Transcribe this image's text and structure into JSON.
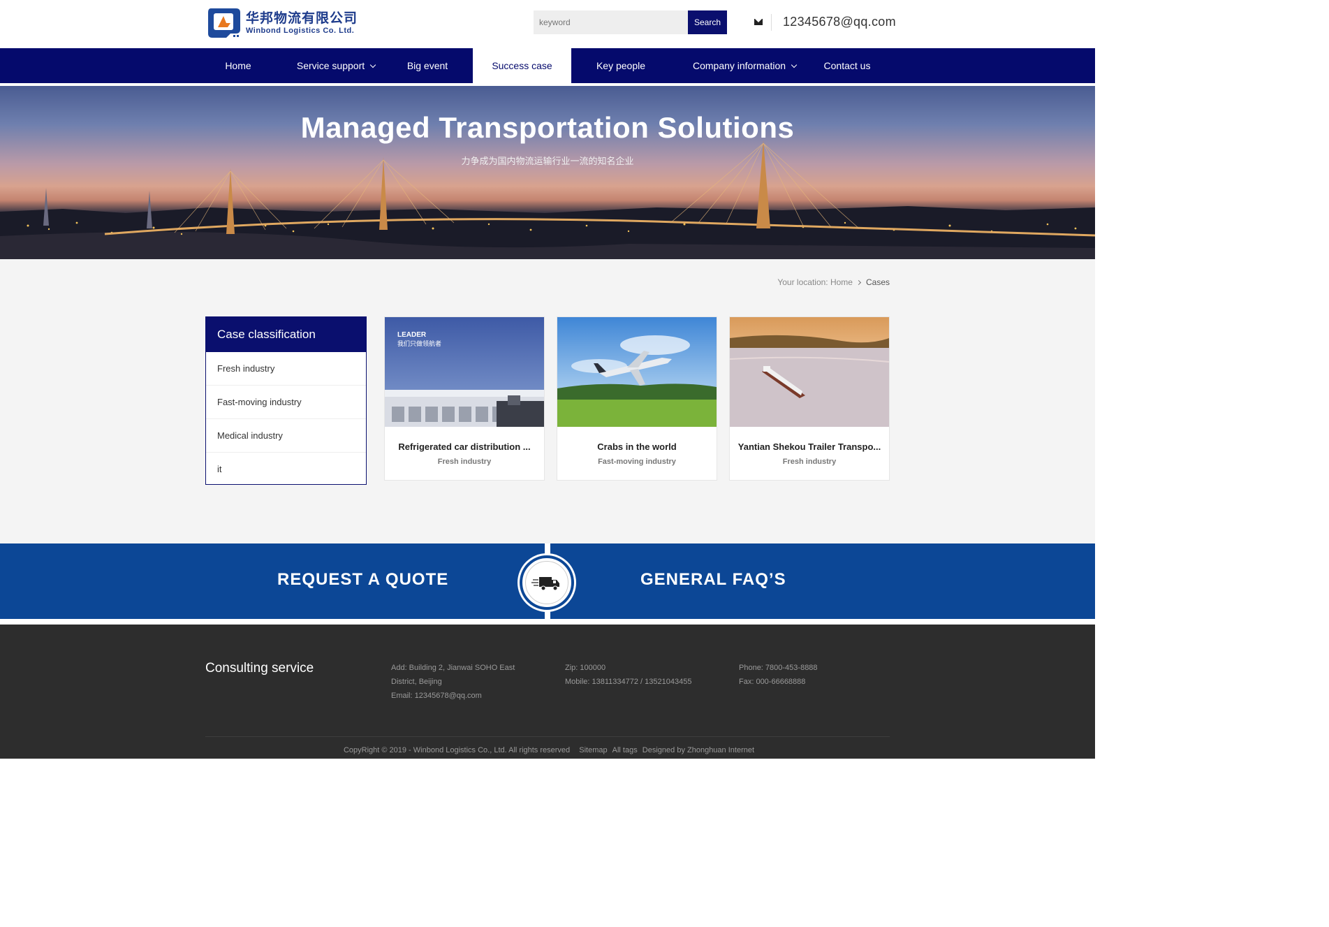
{
  "header": {
    "logo_cn": "华邦物流有限公司",
    "logo_en": "Winbond Logistics Co. Ltd.",
    "search_placeholder": "keyword",
    "search_button": "Search",
    "email": "12345678@qq.com"
  },
  "nav": {
    "items": [
      {
        "label": "Home"
      },
      {
        "label": "Service support"
      },
      {
        "label": "Big event"
      },
      {
        "label": "Success case"
      },
      {
        "label": "Key people"
      },
      {
        "label": "Company information"
      },
      {
        "label": "Contact us"
      }
    ],
    "active": "Success case"
  },
  "banner": {
    "title": "Managed Transportation Solutions",
    "subtitle": "力争成为国内物流运输行业一流的知名企业"
  },
  "breadcrumb": {
    "prefix": "Your location:",
    "home": "Home",
    "current": "Cases"
  },
  "sidebar": {
    "title": "Case classification",
    "items": [
      {
        "label": "Fresh industry"
      },
      {
        "label": "Fast-moving industry"
      },
      {
        "label": "Medical industry"
      },
      {
        "label": "it"
      }
    ]
  },
  "cases": [
    {
      "title": "Refrigerated car distribution ...",
      "category": "Fresh industry",
      "image_text": "LEADER",
      "image_subtext": "我们只做领航者"
    },
    {
      "title": "Crabs in the world",
      "category": "Fast-moving industry"
    },
    {
      "title": "Yantian Shekou Trailer Transpo...",
      "category": "Fresh industry"
    }
  ],
  "quote_bar": {
    "left": "REQUEST A QUOTE",
    "right": "GENERAL FAQ’S",
    "center_icon": "truck-icon"
  },
  "footer": {
    "title": "Consulting service",
    "address_1": "Add: Building 2, Jianwai SOHO East",
    "address_2": "District, Beijing",
    "email_label": "Email:",
    "email": "12345678@qq.com",
    "zip": "Zip: 100000",
    "mobile": "Mobile: 13811334772 / 13521043455",
    "phone": "Phone: 7800-453-8888",
    "fax": "Fax: 000-66668888",
    "copyright": "CopyRight © 2019 - Winbond Logistics Co., Ltd. All rights reserved",
    "sitemap": "Sitemap",
    "all_tags": "All tags",
    "designed_by": "Designed by Zhonghuan Internet"
  },
  "colors": {
    "nav_bg": "#050a6c",
    "quote_bg": "#0c4796",
    "footer_bg": "#2d2d2d",
    "content_bg": "#f4f4f4"
  }
}
